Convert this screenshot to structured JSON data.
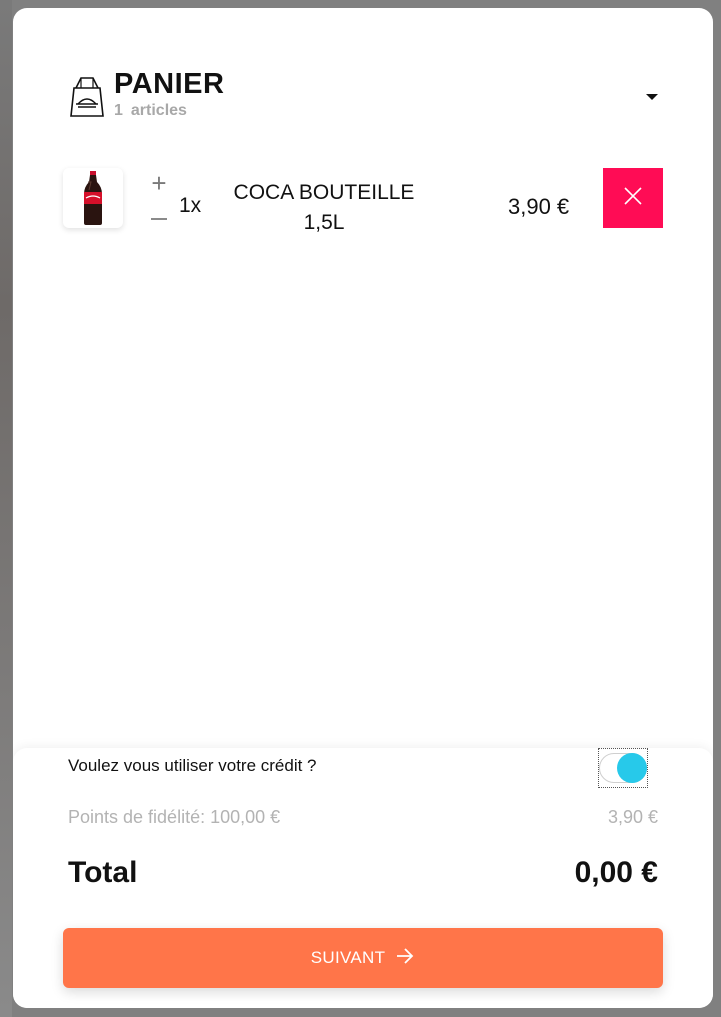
{
  "cart": {
    "title": "PANIER",
    "item_count": "1",
    "item_count_suffix": "articles",
    "icons": {
      "bag": "shopping-bag-icon",
      "collapse": "caret-down-icon"
    }
  },
  "items": [
    {
      "quantity": "1x",
      "name": "COCA BOUTEILLE 1,5L",
      "price": "3,90 €",
      "increment_label": "+",
      "delete_icon": "close-icon"
    }
  ],
  "footer": {
    "credit_question": "Voulez vous utiliser votre crédit ?",
    "credit_toggle_on": true,
    "loyalty_label": "Points de fidélité: 100,00 €",
    "loyalty_value": "3,90 €",
    "total_label": "Total",
    "total_value": "0,00 €",
    "next_label": "SUIVANT",
    "next_icon": "arrow-right-icon"
  },
  "colors": {
    "delete": "#ff0c55",
    "toggle": "#27c9ea",
    "primary_button": "#ff7549"
  }
}
